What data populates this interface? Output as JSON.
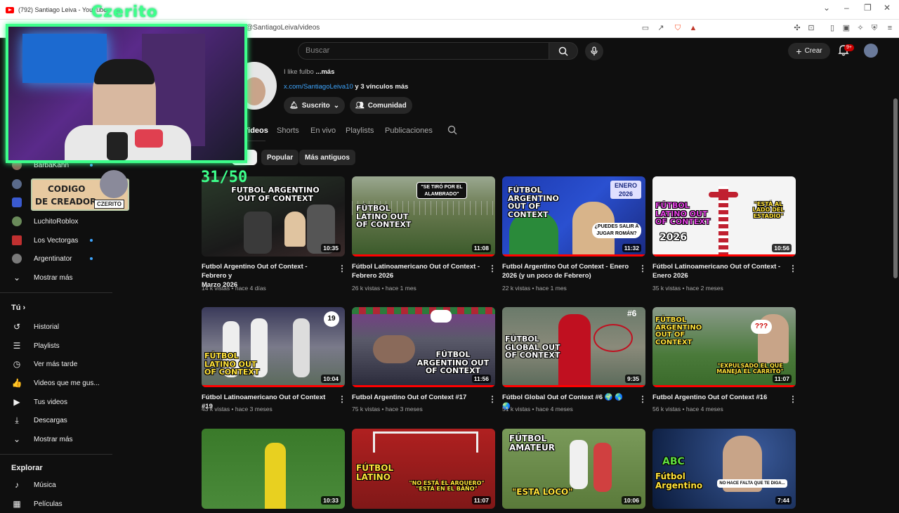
{
  "browser": {
    "tab_title": "(792) Santiago Leiva - YouTube",
    "url": "youtube.com/@SantiagoLeiva/videos"
  },
  "overlay": {
    "cam_name": "Czerito",
    "creator_code_line1": "CODIGO",
    "creator_code_line2": "DE CREADOR",
    "creator_tag": "CZERITO",
    "counter": "31/50"
  },
  "header": {
    "search_placeholder": "Buscar",
    "create_label": "Crear",
    "notif_badge": "9+"
  },
  "channel": {
    "desc_text": "I like fulbo",
    "desc_more": "...más",
    "link": "x.com/SantiagoLeiva10",
    "link_more": " y 3 vínculos más",
    "subscribed_label": "Suscrito",
    "community_label": "Comunidad",
    "tabs": [
      "Videos",
      "Shorts",
      "En vivo",
      "Playlists",
      "Publicaciones"
    ],
    "chips": [
      "s",
      "Popular",
      "Más antiguos"
    ]
  },
  "sidebar": {
    "subs": [
      {
        "label": "BarbaKahn"
      },
      {
        "label": ""
      },
      {
        "label": ""
      },
      {
        "label": "LuchitoRoblox"
      },
      {
        "label": "Los Vectorgas"
      },
      {
        "label": "Argentinator"
      },
      {
        "label": "Mostrar más"
      }
    ],
    "you_heading": "Tú",
    "you_items": [
      "Historial",
      "Playlists",
      "Ver más tarde",
      "Videos que me gus...",
      "Tus videos",
      "Descargas",
      "Mostrar más"
    ],
    "explore_heading": "Explorar",
    "explore_items": [
      "Música",
      "Películas"
    ]
  },
  "videos": [
    {
      "title_l1": "Futbol Argentino Out of Context - Febrero y",
      "title_l2": "Marzo 2026",
      "meta": "14 k vistas • hace 4 días",
      "duration": "10:35",
      "thumb_text": "FUTBOL ARGENTINO OUT OF CONTEXT"
    },
    {
      "title_l1": "Fútbol Latinoamericano Out of Context -",
      "title_l2": "Febrero 2026",
      "meta": "26 k vistas • hace 1 mes",
      "duration": "11:08",
      "thumb_text": "FÚTBOL LATINO OUT OF CONTEXT"
    },
    {
      "title_l1": "Futbol Argentino Out of Context - Enero",
      "title_l2": "2026 (y un poco de Febrero)",
      "meta": "22 k vistas • hace 1 mes",
      "duration": "11:32",
      "thumb_text": "FÚTBOL ARGENTINO OUT OF CONTEXT"
    },
    {
      "title_l1": "Fútbol Latinoamericano Out of Context -",
      "title_l2": "Enero 2026",
      "meta": "35 k vistas • hace 2 meses",
      "duration": "10:56",
      "thumb_text": "FÚTBOL LATINO OUT OF CONTEXT"
    },
    {
      "title_l1": "Fútbol Latinoamericano Out of Context #19",
      "title_l2": "",
      "meta": "43 k vistas • hace 3 meses",
      "duration": "10:04",
      "thumb_text": "FÚTBOL LATINO OUT OF CONTEXT"
    },
    {
      "title_l1": "Futbol Argentino Out of Context #17",
      "title_l2": "",
      "meta": "75 k vistas • hace 3 meses",
      "duration": "11:56",
      "thumb_text": "FÚTBOL ARGENTINO OUT OF CONTEXT"
    },
    {
      "title_l1": "Fútbol Global Out of Context #6 🌍 🌎 🌏",
      "title_l2": "",
      "meta": "51 k vistas • hace 4 meses",
      "duration": "9:35",
      "thumb_text": "FÚTBOL GLOBAL OUT OF CONTEXT"
    },
    {
      "title_l1": "Futbol Argentino Out of Context #16",
      "title_l2": "",
      "meta": "56 k vistas • hace 4 meses",
      "duration": "11:07",
      "thumb_text": "FÚTBOL ARGENTINO OUT OF CONTEXT"
    },
    {
      "title_l1": "",
      "title_l2": "",
      "meta": "",
      "duration": "10:33",
      "thumb_text": ""
    },
    {
      "title_l1": "",
      "title_l2": "",
      "meta": "",
      "duration": "11:07",
      "thumb_text": "FÚTBOL LATINO"
    },
    {
      "title_l1": "",
      "title_l2": "",
      "meta": "",
      "duration": "10:06",
      "thumb_text": "FÚTBOL AMATEUR"
    },
    {
      "title_l1": "",
      "title_l2": "",
      "meta": "",
      "duration": "7:44",
      "thumb_text": "Fútbol Argentino"
    }
  ],
  "thumb_extras": {
    "v2_bubble": "\"SE TIRÓ POR EL ALAMBRADO\"",
    "v3_badge": "ENERO 2026",
    "v3_bubble": "¿PUEDES SALIR A JUGAR ROMÁN?",
    "v4_year": "2026",
    "v4_quote": "\"ESTÁ AL LADO DEL ESTADIO\"",
    "v5_num": "19",
    "v7_num": "#6",
    "v8_quote": "\"EXPULSADO EL QUE MANEJA EL CARRITO\"",
    "v10_quote": "\"NO ESTÁ EL ARQUERO\" \"ESTÁ EN EL BAÑO\"",
    "v11_quote": "\"ESTA LOCO\"",
    "v12_abc": "ABC",
    "v12_quote": "NO HACE FALTA QUE TE DIGA..."
  }
}
